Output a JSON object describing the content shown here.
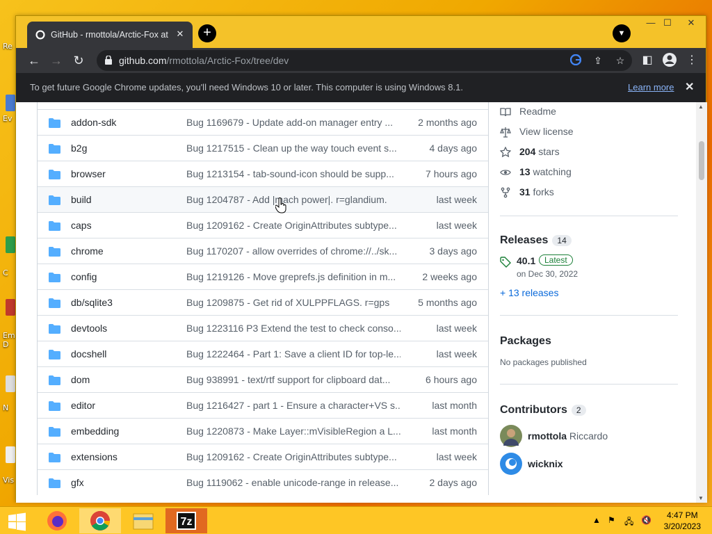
{
  "desktop": {
    "labels": [
      "Re",
      "Ev",
      "C",
      "Em D",
      "N",
      "Vis"
    ]
  },
  "browser": {
    "tab_title": "GitHub - rmottola/Arctic-Fox at d",
    "tab_close": "✕",
    "new_tab": "+",
    "window_controls": [
      "—",
      "☐",
      "✕"
    ],
    "url_host": "github.com",
    "url_path": "/rmottola/Arctic-Fox/tree/dev"
  },
  "infobar": {
    "message": "To get future Google Chrome updates, you'll need Windows 10 or later. This computer is using Windows 8.1.",
    "learn_more": "Learn more",
    "close": "✕"
  },
  "files": [
    {
      "name": "addon-sdk",
      "message": "Bug 1169679 - Update add-on manager entry ...",
      "age": "2 months ago"
    },
    {
      "name": "b2g",
      "message": "Bug 1217515 - Clean up the way touch event s...",
      "age": "4 days ago"
    },
    {
      "name": "browser",
      "message": "Bug 1213154 - tab-sound-icon should be supp...",
      "age": "7 hours ago"
    },
    {
      "name": "build",
      "message": "Bug 1204787 - Add |mach power|. r=glandium.",
      "age": "last week"
    },
    {
      "name": "caps",
      "message": "Bug 1209162 - Create OriginAttributes subtype...",
      "age": "last week"
    },
    {
      "name": "chrome",
      "message": "Bug 1170207 - allow overrides of chrome://../sk...",
      "age": "3 days ago"
    },
    {
      "name": "config",
      "message": "Bug 1219126 - Move greprefs.js definition in m...",
      "age": "2 weeks ago"
    },
    {
      "name": "db/sqlite3",
      "message": "Bug 1209875 - Get rid of XULPPFLAGS. r=gps",
      "age": "5 months ago"
    },
    {
      "name": "devtools",
      "message": "Bug 1223116 P3 Extend the test to check conso...",
      "age": "last week"
    },
    {
      "name": "docshell",
      "message": "Bug 1222464 - Part 1: Save a client ID for top-le...",
      "age": "last week"
    },
    {
      "name": "dom",
      "message": "Bug 938991 - text/rtf support for clipboard dat...",
      "age": "6 hours ago"
    },
    {
      "name": "editor",
      "message": "Bug 1216427 - part 1 - Ensure a character+VS s...",
      "age": "last month"
    },
    {
      "name": "embedding",
      "message": "Bug 1220873 - Make Layer::mVisibleRegion a L...",
      "age": "last month"
    },
    {
      "name": "extensions",
      "message": "Bug 1209162 - Create OriginAttributes subtype...",
      "age": "last week"
    },
    {
      "name": "gfx",
      "message": "Bug 1119062 - enable unicode-range in release...",
      "age": "2 days ago"
    }
  ],
  "sidebar": {
    "readme": "Readme",
    "license": "View license",
    "stars_count": "204",
    "stars_label": "stars",
    "watching_count": "13",
    "watching_label": "watching",
    "forks_count": "31",
    "forks_label": "forks",
    "releases_title": "Releases",
    "releases_count": "14",
    "release_version": "40.1",
    "release_badge": "Latest",
    "release_date": "on Dec 30, 2022",
    "more_releases": "+ 13 releases",
    "packages_title": "Packages",
    "packages_none": "No packages published",
    "contributors_title": "Contributors",
    "contributors_count": "2",
    "contributors": [
      {
        "login": "rmottola",
        "name": "Riccardo"
      },
      {
        "login": "wicknix",
        "name": ""
      }
    ]
  },
  "taskbar": {
    "time": "4:47 PM",
    "date": "3/20/2023",
    "sevenzip": "7z"
  },
  "colors": {
    "link": "#0969da",
    "folder": "#54aeff",
    "chrome_dark": "#35363a",
    "desktop_accent": "#f4c229"
  }
}
